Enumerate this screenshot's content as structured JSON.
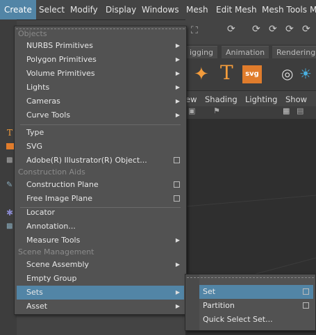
{
  "menubar": {
    "items": [
      "Create",
      "Select",
      "Modify",
      "Display",
      "Windows",
      "Mesh",
      "Edit Mesh",
      "Mesh Tools",
      "M"
    ]
  },
  "shelf": {
    "tabs": [
      "igging",
      "Animation",
      "Rendering"
    ],
    "icons": [
      "T",
      "svg"
    ]
  },
  "panel": {
    "menu": [
      "ew",
      "Shading",
      "Lighting",
      "Show"
    ]
  },
  "create_menu": {
    "sections": {
      "objects": "Objects",
      "construction": "Construction Aids",
      "scene": "Scene Management"
    },
    "items": {
      "nurbs": "NURBS Primitives",
      "polygon": "Polygon Primitives",
      "volume": "Volume Primitives",
      "lights": "Lights",
      "cameras": "Cameras",
      "curve_tools": "Curve Tools",
      "type": "Type",
      "svg": "SVG",
      "illustrator": "Adobe(R) Illustrator(R) Object...",
      "construction_plane": "Construction Plane",
      "free_image_plane": "Free Image Plane",
      "locator": "Locator",
      "annotation": "Annotation...",
      "measure_tools": "Measure Tools",
      "scene_assembly": "Scene Assembly",
      "empty_group": "Empty Group",
      "sets": "Sets",
      "asset": "Asset"
    }
  },
  "sets_submenu": {
    "items": {
      "set": "Set",
      "partition": "Partition",
      "quick_select": "Quick Select Set..."
    }
  }
}
